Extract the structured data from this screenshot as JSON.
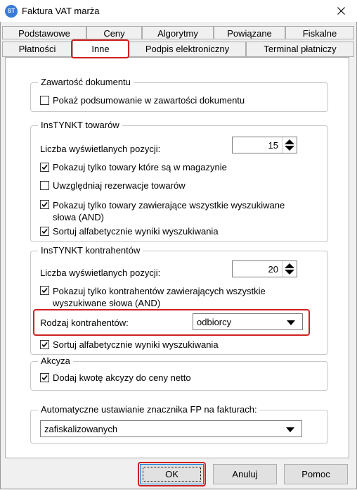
{
  "window": {
    "title": "Faktura VAT marża",
    "app_icon_text": "ST"
  },
  "tabs_row1": [
    {
      "label": "Podstawowe"
    },
    {
      "label": "Ceny"
    },
    {
      "label": "Algorytmy"
    },
    {
      "label": "Powiązane"
    },
    {
      "label": "Fiskalne"
    }
  ],
  "tabs_row2": [
    {
      "label": "Płatności"
    },
    {
      "label": "Inne"
    },
    {
      "label": "Podpis elektroniczny"
    },
    {
      "label": "Terminal płatniczy"
    }
  ],
  "groups": {
    "zawartosc": {
      "legend": "Zawartość dokumentu",
      "show_summary": {
        "label": "Pokaż podsumowanie w zawartości dokumentu",
        "checked": false
      }
    },
    "towary": {
      "legend": "InsTYNKT towarów",
      "count_label": "Liczba wyświetlanych pozycji:",
      "count_value": "15",
      "only_in_stock": {
        "label": "Pokazuj tylko towary które są w magazynie",
        "checked": true
      },
      "reservations": {
        "label": "Uwzględniaj rezerwacje towarów",
        "checked": false
      },
      "all_words_line1": "Pokazuj tylko towary zawierające wszystkie wyszukiwane",
      "all_words_line2": "słowa (AND)",
      "all_words_checked": true,
      "sort": {
        "label": "Sortuj alfabetycznie wyniki wyszukiwania",
        "checked": true
      }
    },
    "kontrahenci": {
      "legend": "InsTYNKT kontrahentów",
      "count_label": "Liczba wyświetlanych pozycji:",
      "count_value": "20",
      "all_words_line1": "Pokazuj tylko kontrahentów zawierających wszystkie",
      "all_words_line2": "wyszukiwane słowa (AND)",
      "all_words_checked": true,
      "type_label": "Rodzaj kontrahentów:",
      "type_value": "odbiorcy",
      "sort": {
        "label": "Sortuj alfabetycznie wyniki wyszukiwania",
        "checked": true
      }
    },
    "akcyza": {
      "legend": "Akcyza",
      "add_excise": {
        "label": "Dodaj kwotę akcyzy do ceny netto",
        "checked": true
      }
    },
    "fp": {
      "legend": "Automatyczne ustawianie znacznika FP na fakturach:",
      "value": "zafiskalizowanych"
    }
  },
  "buttons": {
    "ok": "OK",
    "cancel": "Anuluj",
    "help": "Pomoc"
  },
  "colors": {
    "highlight": "#d02020",
    "accent": "#0078d7"
  }
}
